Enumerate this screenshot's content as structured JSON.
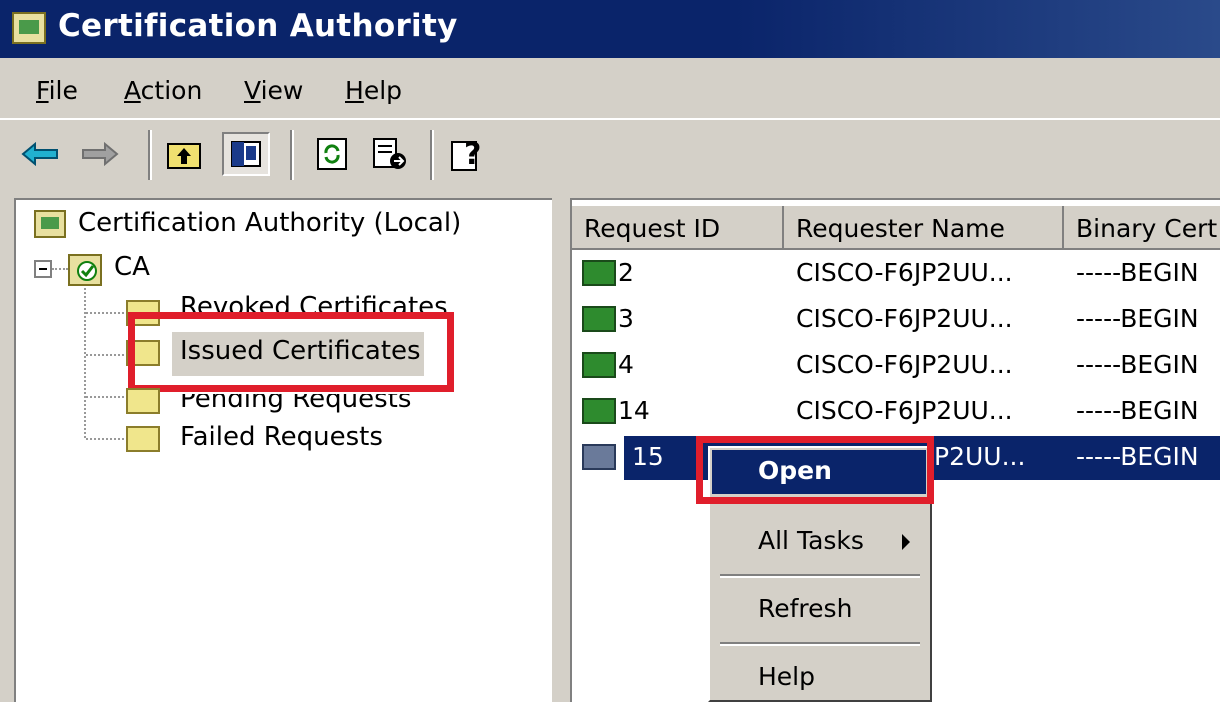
{
  "window": {
    "title": "Certification Authority"
  },
  "menubar": {
    "items": [
      {
        "label": "File",
        "u": "F",
        "rest": "ile"
      },
      {
        "label": "Action",
        "u": "A",
        "rest": "ction"
      },
      {
        "label": "View",
        "u": "V",
        "rest": "iew"
      },
      {
        "label": "Help",
        "u": "H",
        "rest": "elp"
      }
    ]
  },
  "toolbar": {
    "icons": [
      "back-arrow-icon",
      "forward-arrow-icon",
      "up-folder-icon",
      "show-hide-tree-icon",
      "refresh-icon",
      "export-list-icon",
      "help-icon"
    ]
  },
  "tree": {
    "root": "Certification Authority (Local)",
    "ca": "CA",
    "children": [
      "Revoked Certificates",
      "Issued Certificates",
      "Pending Requests",
      "Failed Requests"
    ]
  },
  "list": {
    "columns": [
      "Request ID",
      "Requester Name",
      "Binary Cert"
    ],
    "rows": [
      {
        "id": "2",
        "requester": "CISCO-F6JP2UU...",
        "binary": "-----BEGIN"
      },
      {
        "id": "3",
        "requester": "CISCO-F6JP2UU...",
        "binary": "-----BEGIN"
      },
      {
        "id": "4",
        "requester": "CISCO-F6JP2UU...",
        "binary": "-----BEGIN"
      },
      {
        "id": "14",
        "requester": "CISCO-F6JP2UU...",
        "binary": "-----BEGIN"
      },
      {
        "id": "15",
        "requester": "P2UU...",
        "binary": "-----BEGIN"
      }
    ]
  },
  "context_menu": {
    "items": [
      "Open",
      "All Tasks",
      "Refresh",
      "Help"
    ]
  },
  "colors": {
    "titlebar": "#0a246a",
    "highlight": "#e01e2b",
    "face": "#d4d0c8"
  }
}
